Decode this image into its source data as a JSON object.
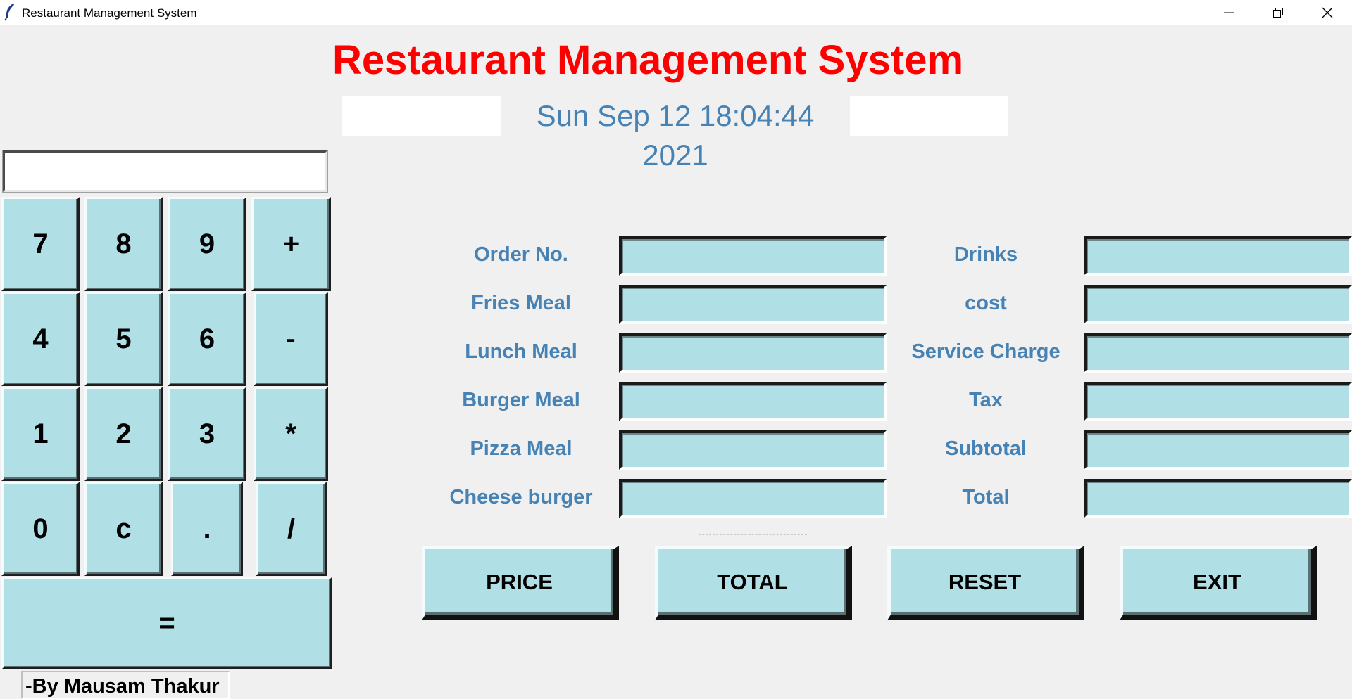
{
  "window": {
    "title": "Restaurant Management System",
    "controls": [
      "minimize-icon",
      "restore-icon",
      "close-icon"
    ]
  },
  "header": {
    "title": "Restaurant Management System",
    "datetime": "Sun Sep 12 18:04:44 2021"
  },
  "calculator": {
    "display_value": "",
    "keys": [
      "7",
      "8",
      "9",
      "+",
      "4",
      "5",
      "6",
      "-",
      "1",
      "2",
      "3",
      "*",
      "0",
      "c",
      ".",
      "/"
    ],
    "equals_label": "="
  },
  "form": {
    "left_labels": [
      "Order No.",
      "Fries Meal",
      "Lunch Meal",
      "Burger Meal",
      "Pizza Meal",
      "Cheese burger"
    ],
    "right_labels": [
      "Drinks",
      "cost",
      "Service Charge",
      "Tax",
      "Subtotal",
      "Total"
    ],
    "left_values": [
      "",
      "",
      "",
      "",
      "",
      ""
    ],
    "right_values": [
      "",
      "",
      "",
      "",
      "",
      ""
    ]
  },
  "actions": {
    "price": "PRICE",
    "total": "TOTAL",
    "reset": "RESET",
    "exit": "EXIT"
  },
  "footer": {
    "credit": "-By Mausam Thakur"
  },
  "colors": {
    "title": "#ff0000",
    "label": "#4682b4",
    "widget_bg": "#b0e0e6",
    "window_bg": "#f0f0f0"
  }
}
